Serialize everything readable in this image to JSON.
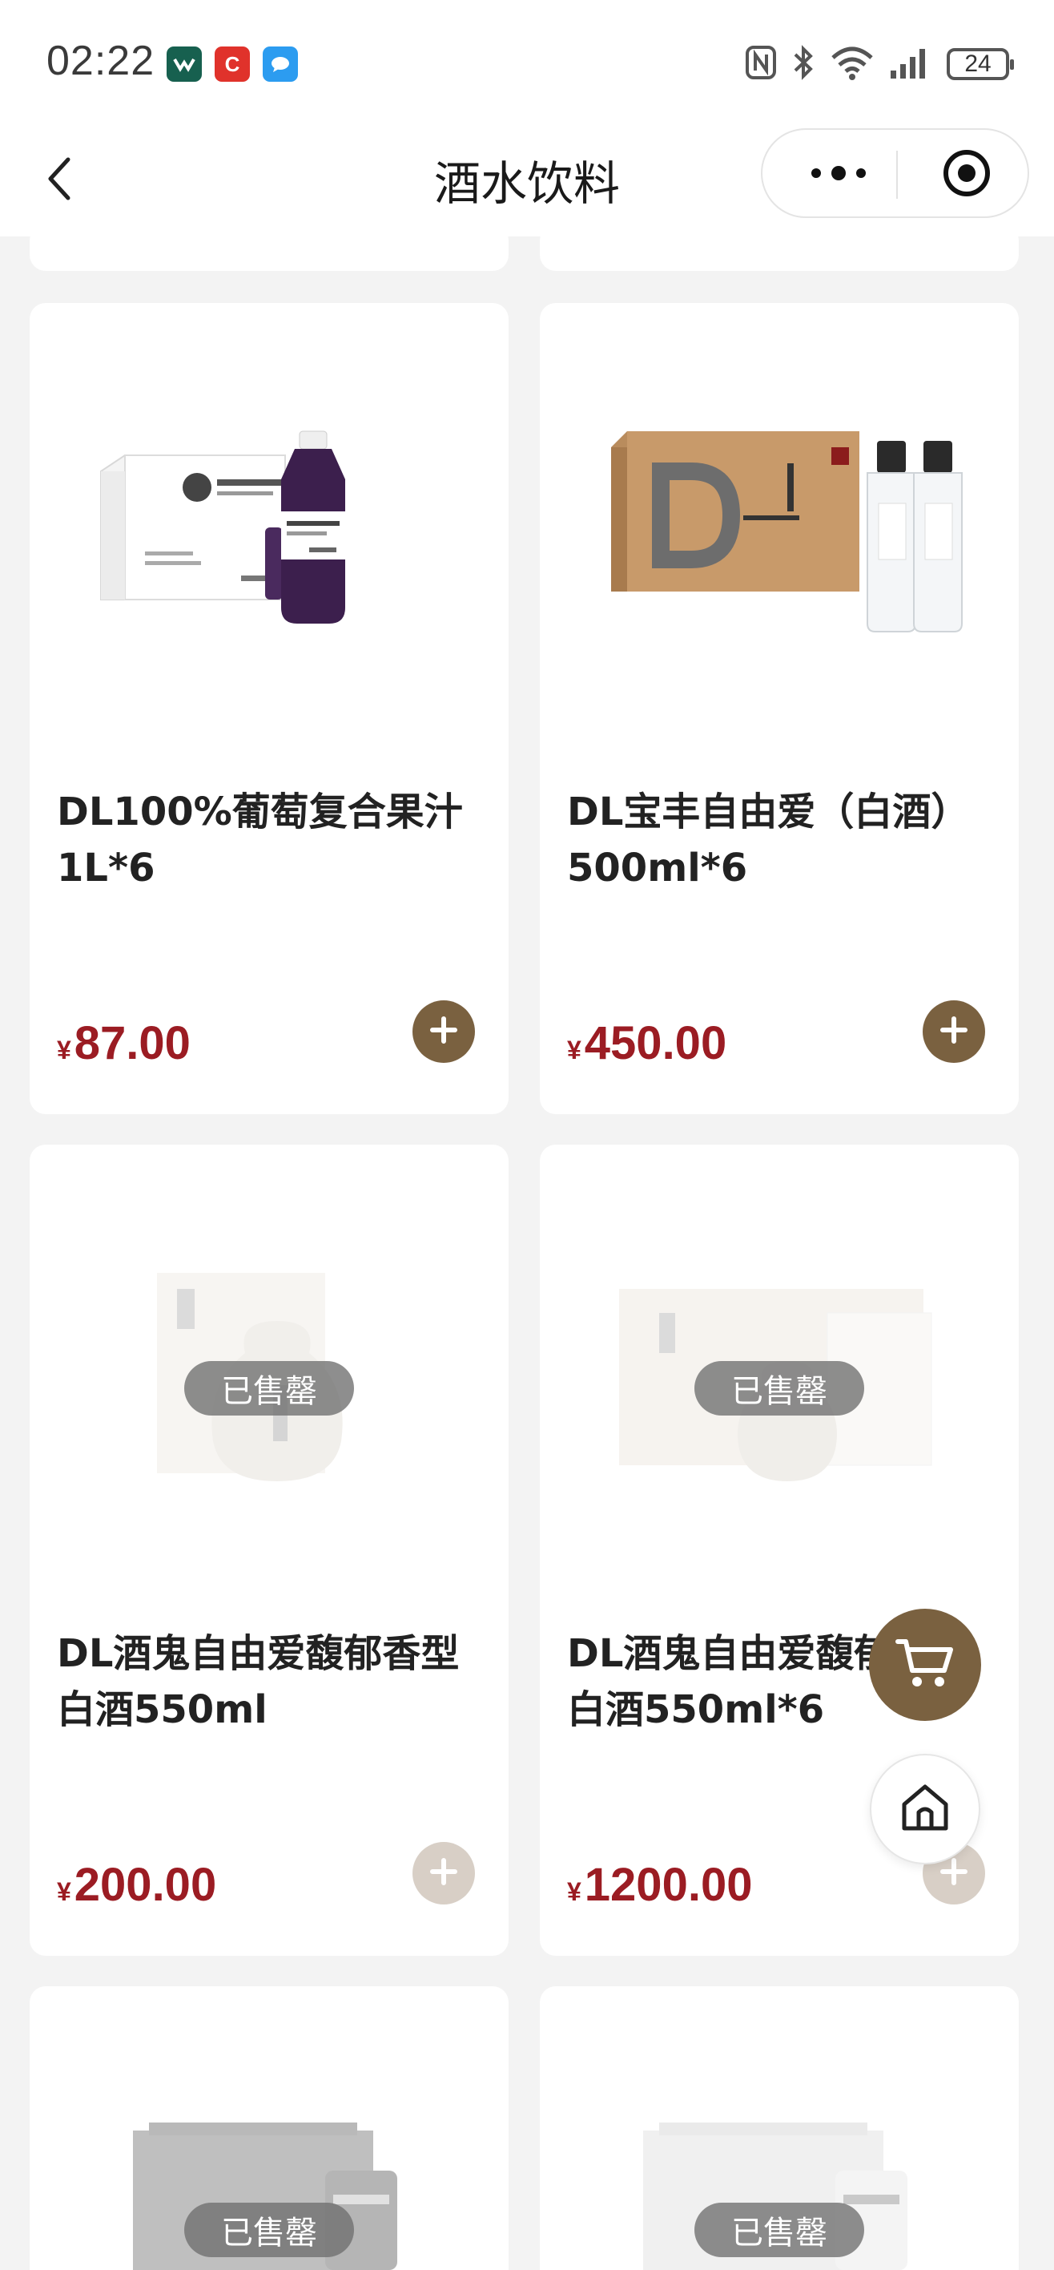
{
  "status_bar": {
    "time": "02:22",
    "battery": "24",
    "app_icons": [
      "app-icon-green",
      "app-icon-c",
      "app-icon-message"
    ],
    "indicators": [
      "nfc-icon",
      "bluetooth-icon",
      "wifi-icon",
      "signal-icon",
      "battery-icon"
    ]
  },
  "header": {
    "title": "酒水饮料",
    "back_icon": "chevron-left-icon",
    "more_icon": "more-dots-icon",
    "close_icon": "target-close-icon"
  },
  "products": [
    {
      "name": "DL100%葡萄复合果汁1L*6",
      "currency": "¥",
      "price": "87.00",
      "status": "available"
    },
    {
      "name": "DL宝丰自由爱（白酒）500ml*6",
      "currency": "¥",
      "price": "450.00",
      "status": "available"
    },
    {
      "name": "DL酒鬼自由爱馥郁香型白酒550ml",
      "currency": "¥",
      "price": "200.00",
      "status": "sold_out",
      "badge": "已售罄"
    },
    {
      "name": "DL酒鬼自由爱馥郁香型白酒550ml*6",
      "currency": "¥",
      "price": "1200.00",
      "status": "sold_out",
      "badge": "已售罄"
    },
    {
      "name": "",
      "status": "sold_out",
      "badge": "已售罄"
    },
    {
      "name": "",
      "status": "sold_out",
      "badge": "已售罄"
    }
  ],
  "colors": {
    "accent": "#7a6140",
    "price": "#9b1c23",
    "background": "#f3f3f3",
    "sold_out_badge": "#6e6e6e"
  },
  "floating": {
    "cart_icon": "cart-icon",
    "home_icon": "home-icon"
  }
}
